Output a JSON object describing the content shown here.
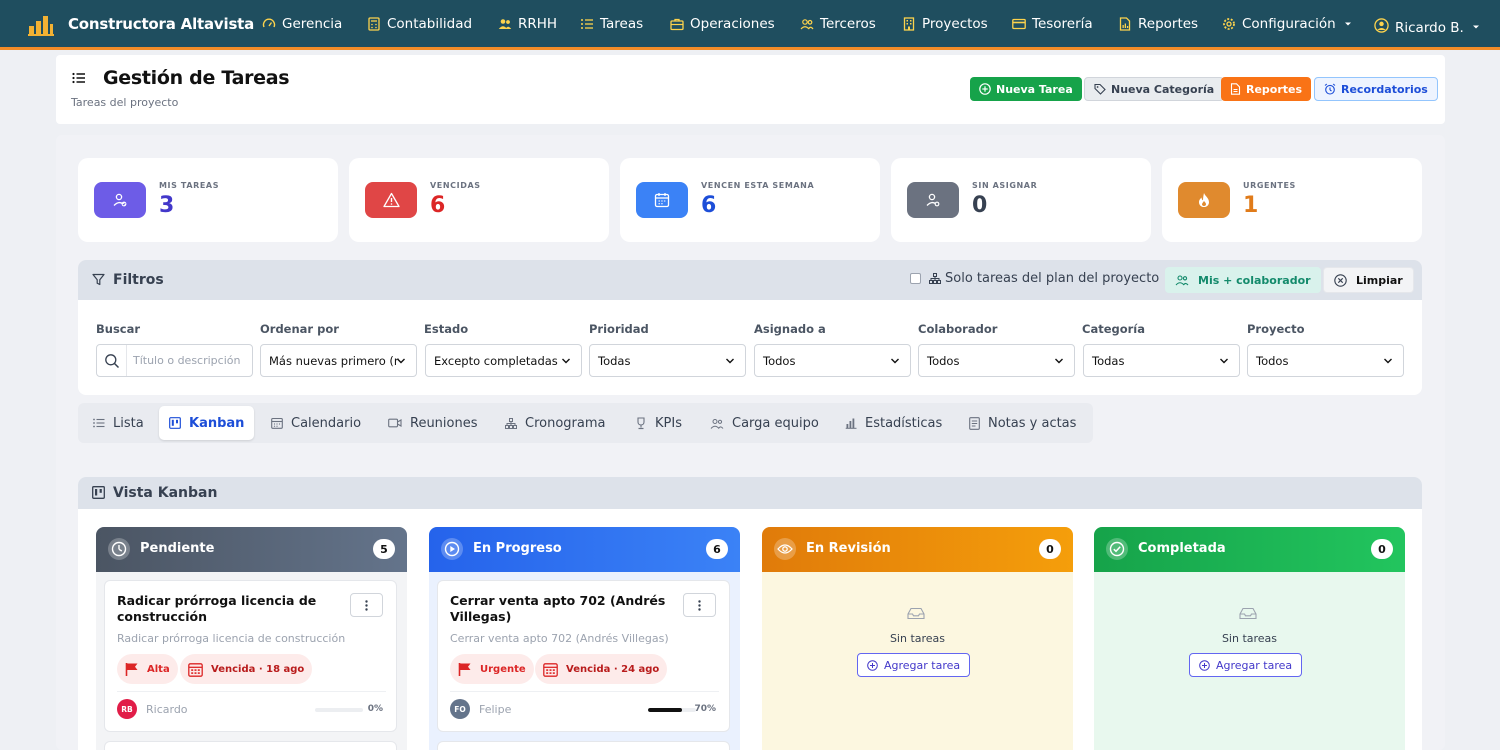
{
  "navbar": {
    "brand": "Constructora Altavista",
    "items": [
      {
        "label": "Gerencia",
        "icon": "gauge-icon"
      },
      {
        "label": "Contabilidad",
        "icon": "calculator-icon"
      },
      {
        "label": "RRHH",
        "icon": "users-icon"
      },
      {
        "label": "Tareas",
        "icon": "list-icon"
      },
      {
        "label": "Operaciones",
        "icon": "briefcase-icon"
      },
      {
        "label": "Terceros",
        "icon": "people-icon"
      },
      {
        "label": "Proyectos",
        "icon": "building-icon"
      },
      {
        "label": "Tesorería",
        "icon": "card-icon"
      },
      {
        "label": "Reportes",
        "icon": "chart-file-icon"
      },
      {
        "label": "Configuración",
        "icon": "gear-icon"
      }
    ],
    "user": "Ricardo B."
  },
  "header": {
    "title": "Gestión de Tareas",
    "subtitle": "Tareas del proyecto",
    "buttons": {
      "new_task": "Nueva Tarea",
      "new_category": "Nueva Categoría",
      "reports": "Reportes",
      "reminders": "Recordatorios"
    }
  },
  "stats": [
    {
      "label": "MIS TAREAS",
      "value": "3",
      "color": "#4338ca",
      "icon": "user-check-icon"
    },
    {
      "label": "VENCIDAS",
      "value": "6",
      "color": "#dc2626",
      "icon": "warning-icon"
    },
    {
      "label": "VENCEN ESTA SEMANA",
      "value": "6",
      "color": "#1d4ed8",
      "icon": "calendar-icon"
    },
    {
      "label": "SIN ASIGNAR",
      "value": "0",
      "color": "#374151",
      "icon": "user-x-icon"
    },
    {
      "label": "URGENTES",
      "value": "1",
      "color": "#e07b1a",
      "icon": "fire-icon"
    }
  ],
  "filters": {
    "title": "Filtros",
    "plan_only": "Solo tareas del plan del proyecto",
    "mine_collab": "Mis + colaborador",
    "clear": "Limpiar",
    "search_label": "Buscar",
    "search_placeholder": "Título o descripción",
    "fields": [
      {
        "label": "Ordenar por",
        "value": "Más nuevas primero (reciente)"
      },
      {
        "label": "Estado",
        "value": "Excepto completadas"
      },
      {
        "label": "Prioridad",
        "value": "Todas"
      },
      {
        "label": "Asignado a",
        "value": "Todos"
      },
      {
        "label": "Colaborador",
        "value": "Todos"
      },
      {
        "label": "Categoría",
        "value": "Todas"
      },
      {
        "label": "Proyecto",
        "value": "Todos"
      }
    ]
  },
  "tabs": [
    {
      "label": "Lista",
      "icon": "list-icon"
    },
    {
      "label": "Kanban",
      "icon": "kanban-icon",
      "active": true
    },
    {
      "label": "Calendario",
      "icon": "calendar-icon"
    },
    {
      "label": "Reuniones",
      "icon": "video-icon"
    },
    {
      "label": "Cronograma",
      "icon": "sitemap-icon"
    },
    {
      "label": "KPIs",
      "icon": "trophy-icon"
    },
    {
      "label": "Carga equipo",
      "icon": "team-icon"
    },
    {
      "label": "Estadísticas",
      "icon": "bars-icon"
    },
    {
      "label": "Notas y actas",
      "icon": "notes-icon"
    }
  ],
  "kanban": {
    "title": "Vista Kanban",
    "columns": [
      {
        "title": "Pendiente",
        "count": "5",
        "color": "#4b5563",
        "card": {
          "title": "Radicar prórroga licencia de construcción",
          "desc": "Radicar prórroga licencia de construcción",
          "priority": "Alta",
          "due": "Vencida · 18 ago",
          "initials": "RB",
          "avatar_color": "#e11d48",
          "user": "Ricardo",
          "progress": 0,
          "progress_label": "0%"
        }
      },
      {
        "title": "En Progreso",
        "count": "6",
        "color": "#2563eb",
        "card": {
          "title": "Cerrar venta apto 702 (Andrés Villegas)",
          "desc": "Cerrar venta apto 702 (Andrés Villegas)",
          "priority": "Urgente",
          "due": "Vencida · 24 ago",
          "initials": "FO",
          "avatar_color": "#64748b",
          "user": "Felipe",
          "progress": 70,
          "progress_label": "70%"
        }
      },
      {
        "title": "En Revisión",
        "count": "0",
        "color": "#e07b0a",
        "empty": "Sin tareas",
        "add": "Agregar tarea"
      },
      {
        "title": "Completada",
        "count": "0",
        "color": "#16a34a",
        "empty": "Sin tareas",
        "add": "Agregar tarea"
      }
    ]
  }
}
